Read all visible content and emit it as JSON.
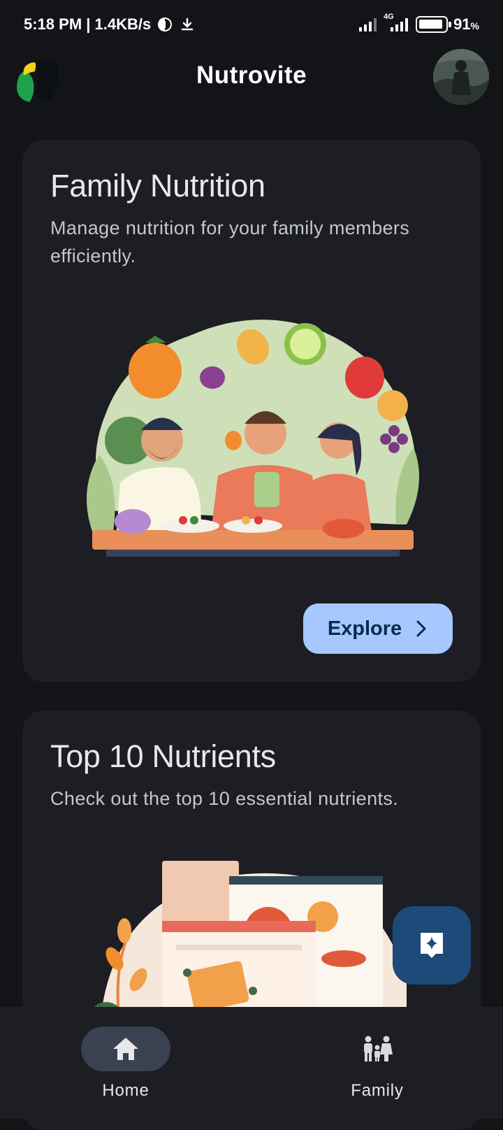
{
  "status_bar": {
    "time_speed": "5:18 PM | 1.4KB/s",
    "network": "4G",
    "battery_percent": "91",
    "battery_unit": "%",
    "battery_level": 0.91
  },
  "app_bar": {
    "title": "Nutrovite",
    "logo_icon": "app-logo",
    "avatar_icon": "user-avatar"
  },
  "cards": [
    {
      "title": "Family Nutrition",
      "description": "Manage nutrition for your family members efficiently.",
      "button_label": "Explore",
      "illustration": "family-dining-illustration"
    },
    {
      "title": "Top 10 Nutrients",
      "description": "Check out the top 10 essential nutrients.",
      "illustration": "nutrients-illustration"
    }
  ],
  "fab": {
    "icon": "sparkle-icon"
  },
  "bottom_nav": {
    "items": [
      {
        "label": "Home",
        "icon": "home-icon",
        "selected": true
      },
      {
        "label": "Family",
        "icon": "family-icon",
        "selected": false
      }
    ]
  },
  "colors": {
    "background": "#121418",
    "card": "#1c1e23",
    "accent_button": "#a6c8ff",
    "fab": "#1d4a79",
    "nav_selected": "#3a4150"
  }
}
